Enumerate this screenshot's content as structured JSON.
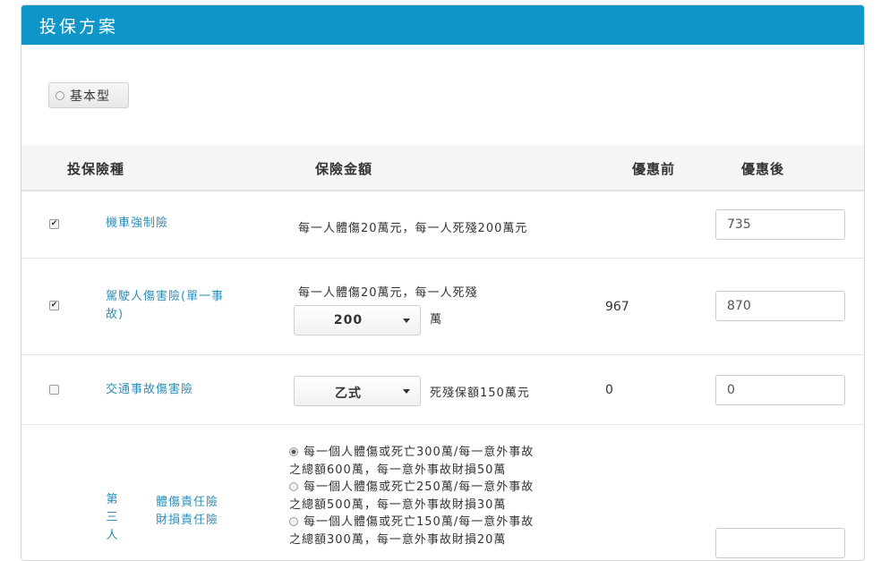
{
  "panel": {
    "title": "投保方案"
  },
  "plan": {
    "label": "基本型"
  },
  "table": {
    "headers": {
      "type": "投保險種",
      "amount": "保險金額",
      "before": "優惠前",
      "after": "優惠後"
    }
  },
  "rows": {
    "r1": {
      "checked": "✔",
      "name": "機車強制險",
      "amount_text": "每一人體傷20萬元，每一人死殘200萬元",
      "after": "735"
    },
    "r2": {
      "checked": "✔",
      "name_line1": "駕駛人傷害險(單一事",
      "name_line2": "故)",
      "amount_text": "每一人體傷20萬元，每一人死殘",
      "select_value": "200",
      "unit": "萬",
      "before": "967",
      "after": "870"
    },
    "r3": {
      "checked": "",
      "name": "交通事故傷害險",
      "select_value": "乙式",
      "amount_text": "死殘保額150萬元",
      "before": "0",
      "after": "0"
    },
    "r4": {
      "name_vertical": [
        "第",
        "三",
        "人"
      ],
      "name_line1": "體傷責任險",
      "name_line2": "財損責任險",
      "options": [
        {
          "line1": "每一個人體傷或死亡300萬/每一意外事故",
          "line2": "之總額600萬，每一意外事故財損50萬",
          "selected": true
        },
        {
          "line1": "每一個人體傷或死亡250萬/每一意外事故",
          "line2": "之總額500萬，每一意外事故財損30萬",
          "selected": false
        },
        {
          "line1": "每一個人體傷或死亡150萬/每一意外事故",
          "line2": "之總額300萬，每一意外事故財損20萬",
          "selected": false
        }
      ]
    }
  },
  "colors": {
    "header": "#0f95c8",
    "link": "#2d8fb8"
  }
}
